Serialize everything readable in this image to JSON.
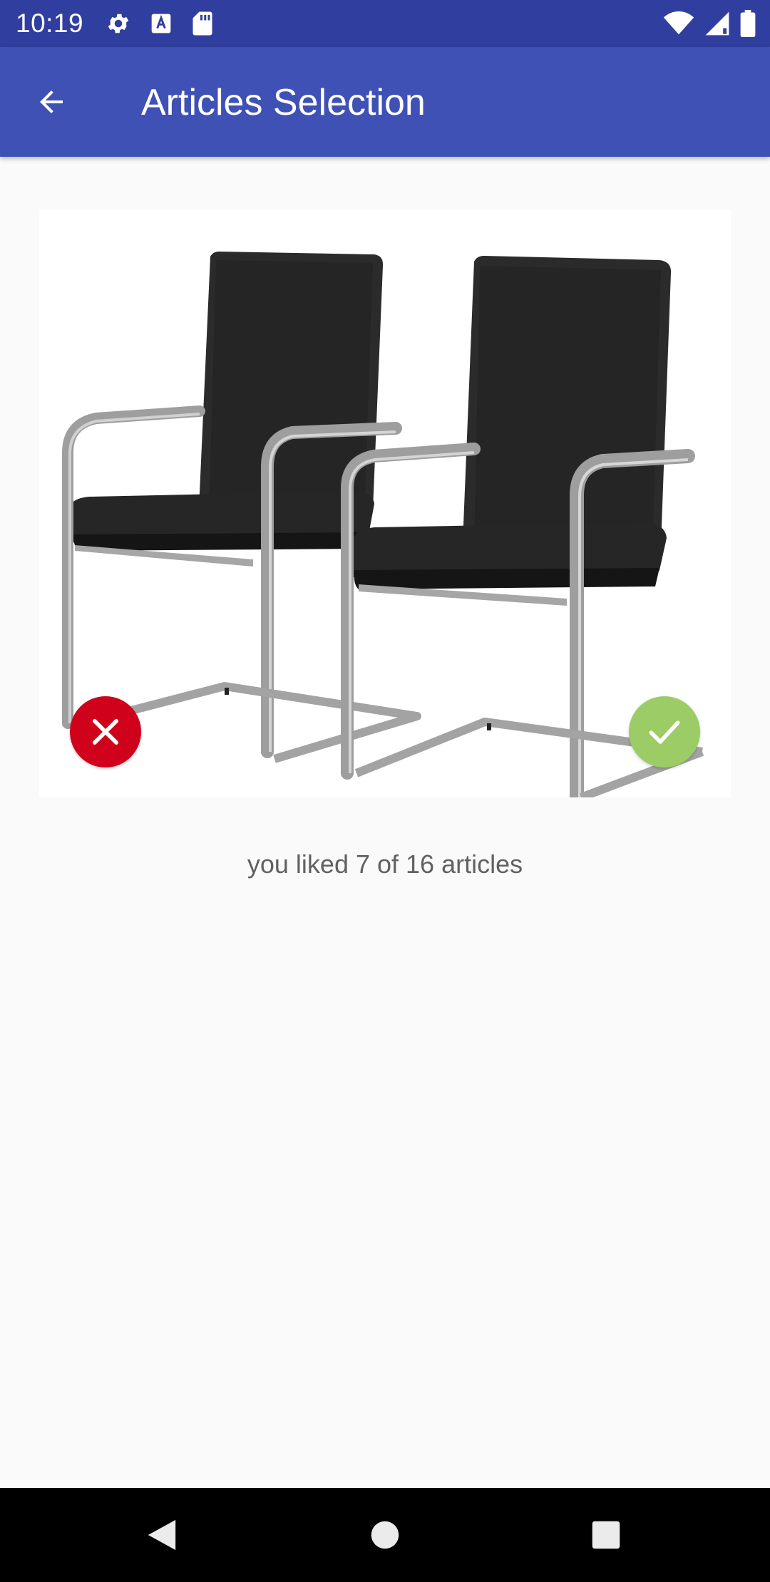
{
  "status_bar": {
    "time": "10:19",
    "left_icons": [
      "settings-icon",
      "keyboard-icon",
      "sd-card-icon"
    ],
    "right_icons": [
      "wifi-icon",
      "cellular-signal-icon",
      "battery-icon"
    ],
    "background_color": "#303f9f"
  },
  "app_bar": {
    "title": "Articles Selection",
    "back_icon": "arrow-back-icon",
    "background_color": "#3f51b5"
  },
  "article": {
    "image": "two-black-leather-cantilever-chairs",
    "dislike_icon": "close-icon",
    "like_icon": "check-icon",
    "dislike_color": "#d0021b",
    "like_color": "#9ccc65"
  },
  "counter": {
    "text": "you liked 7 of 16 articles"
  },
  "nav_bar": {
    "buttons": [
      "back-triangle-icon",
      "home-circle-icon",
      "recents-square-icon"
    ]
  }
}
